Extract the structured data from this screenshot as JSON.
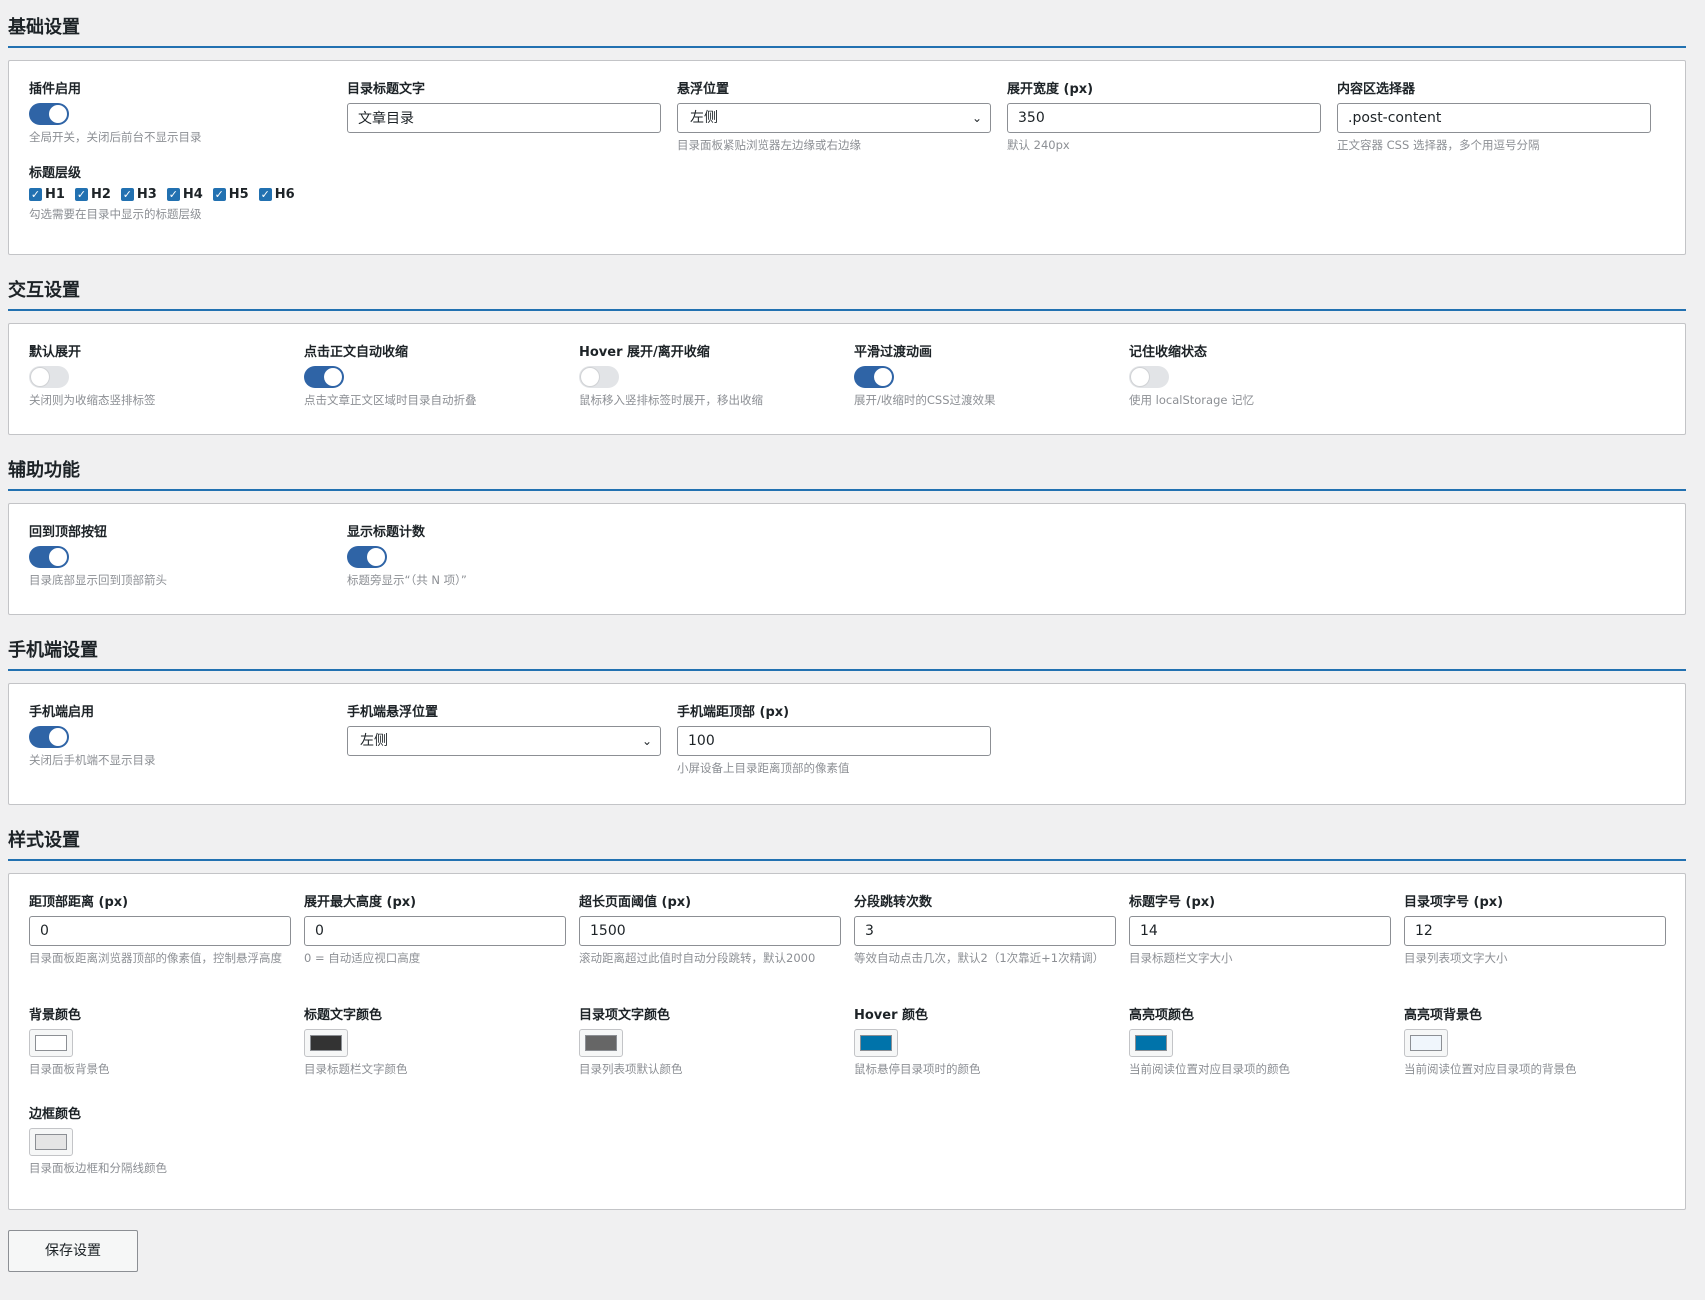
{
  "basic": {
    "title": "基础设置",
    "plugin_enabled": {
      "label": "插件启用",
      "on": true,
      "desc": "全局开关，关闭后前台不显示目录"
    },
    "toc_title": {
      "label": "目录标题文字",
      "value": "文章目录"
    },
    "float_pos": {
      "label": "悬浮位置",
      "value": "左侧",
      "desc": "目录面板紧贴浏览器左边缘或右边缘"
    },
    "expand_width": {
      "label": "展开宽度 (px)",
      "value": "350",
      "desc": "默认 240px"
    },
    "content_selector": {
      "label": "内容区选择器",
      "value": ".post-content",
      "desc": "正文容器 CSS 选择器，多个用逗号分隔"
    },
    "heading_levels": {
      "label": "标题层级",
      "items": [
        "H1",
        "H2",
        "H3",
        "H4",
        "H5",
        "H6"
      ],
      "desc": "勾选需要在目录中显示的标题层级"
    }
  },
  "interaction": {
    "title": "交互设置",
    "default_expand": {
      "label": "默认展开",
      "on": false,
      "desc": "关闭则为收缩态竖排标签"
    },
    "click_collapse": {
      "label": "点击正文自动收缩",
      "on": true,
      "desc": "点击文章正文区域时目录自动折叠"
    },
    "hover_expand": {
      "label": "Hover 展开/离开收缩",
      "on": false,
      "desc": "鼠标移入竖排标签时展开，移出收缩"
    },
    "smooth_anim": {
      "label": "平滑过渡动画",
      "on": true,
      "desc": "展开/收缩时的CSS过渡效果"
    },
    "remember_state": {
      "label": "记住收缩状态",
      "on": false,
      "desc": "使用 localStorage 记忆"
    }
  },
  "aux": {
    "title": "辅助功能",
    "back_to_top": {
      "label": "回到顶部按钮",
      "on": true,
      "desc": "目录底部显示回到顶部箭头"
    },
    "show_count": {
      "label": "显示标题计数",
      "on": true,
      "desc": "标题旁显示“（共 N 项）”"
    }
  },
  "mobile": {
    "title": "手机端设置",
    "enabled": {
      "label": "手机端启用",
      "on": true,
      "desc": "关闭后手机端不显示目录"
    },
    "float_pos": {
      "label": "手机端悬浮位置",
      "value": "左侧"
    },
    "top_offset": {
      "label": "手机端距顶部 (px)",
      "value": "100",
      "desc": "小屏设备上目录距离顶部的像素值"
    }
  },
  "style": {
    "title": "样式设置",
    "top_dist": {
      "label": "距顶部距离 (px)",
      "value": "0",
      "desc": "目录面板距离浏览器顶部的像素值，控制悬浮高度"
    },
    "max_height": {
      "label": "展开最大高度 (px)",
      "value": "0",
      "desc": "0 = 自动适应视口高度"
    },
    "long_threshold": {
      "label": "超长页面阈值 (px)",
      "value": "1500",
      "desc": "滚动距离超过此值时自动分段跳转，默认2000"
    },
    "jump_count": {
      "label": "分段跳转次数",
      "value": "3",
      "desc": "等效自动点击几次，默认2（1次靠近+1次精调）"
    },
    "title_font": {
      "label": "标题字号 (px)",
      "value": "14",
      "desc": "目录标题栏文字大小"
    },
    "item_font": {
      "label": "目录项字号 (px)",
      "value": "12",
      "desc": "目录列表项文字大小"
    },
    "bg_color": {
      "label": "背景颜色",
      "color": "#ffffff",
      "desc": "目录面板背景色"
    },
    "title_color": {
      "label": "标题文字颜色",
      "color": "#333333",
      "desc": "目录标题栏文字颜色"
    },
    "item_color": {
      "label": "目录项文字颜色",
      "color": "#666666",
      "desc": "目录列表项默认颜色"
    },
    "hover_color": {
      "label": "Hover 颜色",
      "color": "#0073aa",
      "desc": "鼠标悬停目录项时的颜色"
    },
    "active_color": {
      "label": "高亮项颜色",
      "color": "#0073aa",
      "desc": "当前阅读位置对应目录项的颜色"
    },
    "active_bg": {
      "label": "高亮项背景色",
      "color": "#f0f6fc",
      "desc": "当前阅读位置对应目录项的背景色"
    },
    "border_color": {
      "label": "边框颜色",
      "color": "#e5e5e5",
      "desc": "目录面板边框和分隔线颜色"
    }
  },
  "save_label": "保存设置"
}
